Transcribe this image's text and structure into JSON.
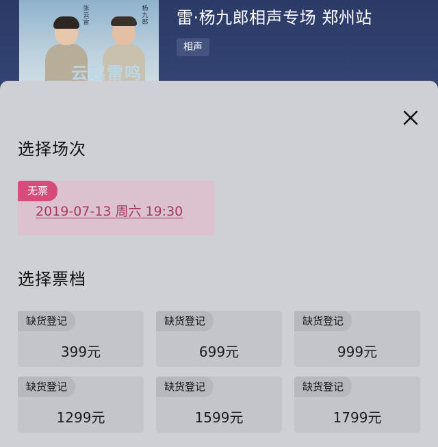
{
  "header": {
    "show_title": "雷·杨九郎相声专场 郑州站",
    "category_tag": "相声",
    "poster_logo": "云起雷鸣",
    "poster_name_left": "张云雷",
    "poster_name_right": "杨九郎"
  },
  "modal": {
    "close_icon": "close-icon",
    "session_section_title": "选择场次",
    "sessions": [
      {
        "badge": "无票",
        "datetime": "2019-07-13 周六 19:30"
      }
    ],
    "tier_section_title": "选择票档",
    "tiers": [
      {
        "tag": "缺货登记",
        "price": "399元"
      },
      {
        "tag": "缺货登记",
        "price": "699元"
      },
      {
        "tag": "缺货登记",
        "price": "999元"
      },
      {
        "tag": "缺货登记",
        "price": "1299元"
      },
      {
        "tag": "缺货登记",
        "price": "1599元"
      },
      {
        "tag": "缺货登记",
        "price": "1799元"
      }
    ]
  },
  "colors": {
    "header_bg": "#2c3a66",
    "sheet_bg": "#cfd0d6",
    "sold_out_badge": "#d54b7a",
    "session_text": "#a8385f",
    "tier_card_bg": "#c4c5cb"
  }
}
